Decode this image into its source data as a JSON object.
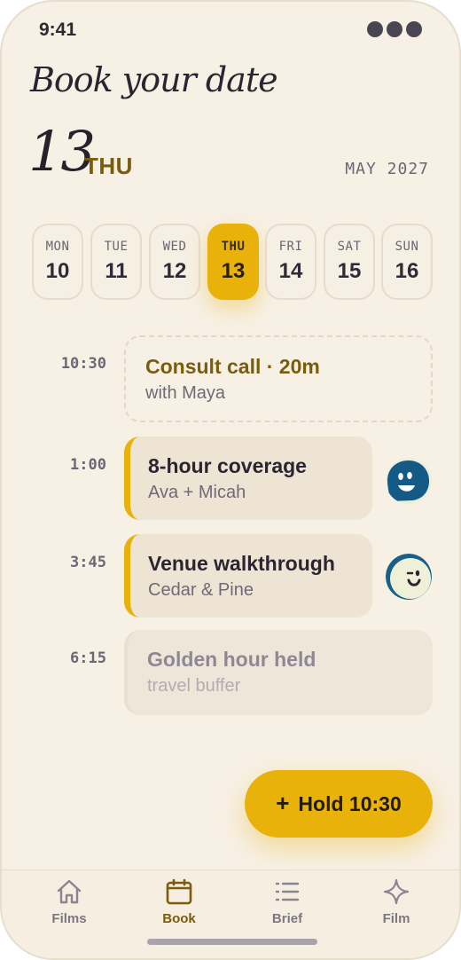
{
  "status": {
    "time": "9:41"
  },
  "header": {
    "title": "Book your date",
    "selected_day": "13",
    "selected_weekday": "THU",
    "month_label": "MAY 2027"
  },
  "week": [
    {
      "dow": "MON",
      "num": "10",
      "selected": false
    },
    {
      "dow": "TUE",
      "num": "11",
      "selected": false
    },
    {
      "dow": "WED",
      "num": "12",
      "selected": false
    },
    {
      "dow": "THU",
      "num": "13",
      "selected": true
    },
    {
      "dow": "FRI",
      "num": "14",
      "selected": false
    },
    {
      "dow": "SAT",
      "num": "15",
      "selected": false
    },
    {
      "dow": "SUN",
      "num": "16",
      "selected": false
    }
  ],
  "schedule": [
    {
      "time": "10:30",
      "title": "Consult call · 20m",
      "subtitle": "with Maya",
      "state": "open"
    },
    {
      "time": "1:00",
      "title": "8-hour coverage",
      "subtitle": "Ava + Micah",
      "state": "booked",
      "avatar": "smiling-blue-face-icon"
    },
    {
      "time": "3:45",
      "title": "Venue walkthrough",
      "subtitle": "Cedar & Pine",
      "state": "booked",
      "avatar": "winking-cream-face-icon"
    },
    {
      "time": "6:15",
      "title": "Golden hour held",
      "subtitle": "travel buffer",
      "state": "held"
    }
  ],
  "fab": {
    "icon": "plus",
    "label": "Hold 10:30"
  },
  "tabs": [
    {
      "label": "Films",
      "icon": "home-icon",
      "active": false
    },
    {
      "label": "Book",
      "icon": "calendar-icon",
      "active": true
    },
    {
      "label": "Brief",
      "icon": "list-icon",
      "active": false
    },
    {
      "label": "Film",
      "icon": "sparkle-icon",
      "active": false
    }
  ],
  "colors": {
    "background": "#f7f0e4",
    "accent": "#e9b20a",
    "accent_text": "#7a5c0d",
    "ink": "#2a2530",
    "muted": "#6f6a77"
  }
}
